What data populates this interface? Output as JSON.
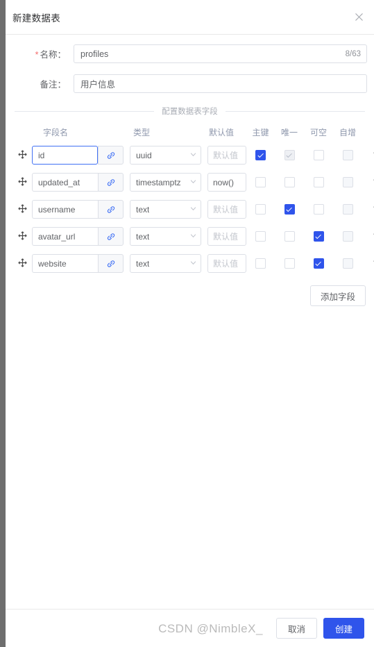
{
  "modal": {
    "title": "新建数据表",
    "close_icon": "close-icon"
  },
  "form": {
    "name_label": "名称：",
    "name_required_mark": "*",
    "name_value": "profiles",
    "name_counter": "8/63",
    "remark_label": "备注：",
    "remark_value": "用户信息"
  },
  "section": {
    "legend": "配置数据表字段"
  },
  "table": {
    "headers": {
      "field_name": "字段名",
      "type": "类型",
      "default": "默认值",
      "primary_key": "主键",
      "unique": "唯一",
      "nullable": "可空",
      "auto_increment": "自增"
    },
    "default_placeholder": "默认值",
    "rows": [
      {
        "name": "id",
        "name_focused": true,
        "type": "uuid",
        "default": "",
        "primary_key": true,
        "primary_key_disabled": false,
        "unique": true,
        "unique_disabled": true,
        "nullable": false,
        "nullable_disabled": false,
        "auto_increment": false,
        "auto_increment_disabled": true
      },
      {
        "name": "updated_at",
        "name_focused": false,
        "type": "timestamptz",
        "default": "now()",
        "primary_key": false,
        "primary_key_disabled": false,
        "unique": false,
        "unique_disabled": false,
        "nullable": false,
        "nullable_disabled": false,
        "auto_increment": false,
        "auto_increment_disabled": true
      },
      {
        "name": "username",
        "name_focused": false,
        "type": "text",
        "default": "",
        "primary_key": false,
        "primary_key_disabled": false,
        "unique": true,
        "unique_disabled": false,
        "nullable": false,
        "nullable_disabled": false,
        "auto_increment": false,
        "auto_increment_disabled": true
      },
      {
        "name": "avatar_url",
        "name_focused": false,
        "type": "text",
        "default": "",
        "primary_key": false,
        "primary_key_disabled": false,
        "unique": false,
        "unique_disabled": false,
        "nullable": true,
        "nullable_disabled": false,
        "auto_increment": false,
        "auto_increment_disabled": true
      },
      {
        "name": "website",
        "name_focused": false,
        "type": "text",
        "default": "",
        "primary_key": false,
        "primary_key_disabled": false,
        "unique": false,
        "unique_disabled": false,
        "nullable": true,
        "nullable_disabled": false,
        "auto_increment": false,
        "auto_increment_disabled": true
      }
    ],
    "add_field_label": "添加字段",
    "icons": {
      "drag": "drag-handle-icon",
      "link": "link-icon",
      "delete": "trash-icon",
      "caret": "chevron-down-icon"
    }
  },
  "footer": {
    "cancel_label": "取消",
    "create_label": "创建"
  },
  "watermark": {
    "text": "CSDN @NimbleX_"
  },
  "colors": {
    "accent": "#2f54eb",
    "focus_border": "#4070f4",
    "required": "#f56c6c",
    "border": "#dcdfe6",
    "text": "#606266",
    "overlay": "#6e6e6e"
  }
}
